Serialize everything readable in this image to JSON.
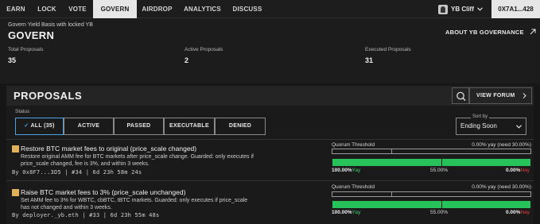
{
  "nav": {
    "tabs": [
      "EARN",
      "LOCK",
      "VOTE",
      "GOVERN",
      "AIRDROP",
      "ANALYTICS",
      "DISCUSS"
    ],
    "active": "GOVERN",
    "user_name": "YB Cliff",
    "wallet": "0X7A1...428"
  },
  "header": {
    "subtitle": "Govern Yield Basis with locked YB",
    "title": "GOVERN",
    "about_link": "ABOUT YB GOVERNANCE",
    "stats": [
      {
        "label": "Total Proposals",
        "value": "35"
      },
      {
        "label": "Active Proposals",
        "value": "2"
      },
      {
        "label": "Executed Proposals",
        "value": "31"
      }
    ]
  },
  "proposals": {
    "title": "PROPOSALS",
    "forum_button": "VIEW FORUM",
    "status_label": "Status",
    "filters": [
      "ALL (35)",
      "ACTIVE",
      "PASSED",
      "EXECUTABLE",
      "DENIED"
    ],
    "active_filter": "ALL (35)",
    "sort_label": "Sort by",
    "sort_value": "Ending Soon",
    "items": [
      {
        "title": "Restore BTC market fees to original (price_scale changed)",
        "description": "Restore original AMM fee for BTC markets after price_scale change. Guarded: only executes if price_scale changed, fee is 3%, and within 3 weeks.",
        "meta": "By 0x8F7...3D5 | #34 | 6d 23h 58m 24s",
        "quorum_label": "Quorum Threshold",
        "quorum_status": "0.00% yay (need 30.00%)",
        "quorum_progress": 0.0,
        "quorum_threshold": 30.0,
        "yay_pct": "100.00%",
        "yay_word": "Yay",
        "pass_threshold": "55.00%",
        "nay_pct": "0.00%",
        "nay_word": "Nay",
        "yay_fraction": 1.0
      },
      {
        "title": "Raise BTC market fees to 3% (price_scale unchanged)",
        "description": "Set AMM fee to 3% for WBTC, cbBTC, tBTC markets. Guarded: only executes if price_scale has not changed and within 3 weeks.",
        "meta": "By deployer._yb.eth | #33 | 6d 23h 55m 48s",
        "quorum_label": "Quorum Threshold",
        "quorum_status": "0.00% yay (need 30.00%)",
        "quorum_progress": 0.0,
        "quorum_threshold": 30.0,
        "yay_pct": "100.00%",
        "yay_word": "Yay",
        "pass_threshold": "55.00%",
        "nay_pct": "0.00%",
        "nay_word": "Nay",
        "yay_fraction": 1.0
      }
    ]
  },
  "colors": {
    "yay": "#27c25a",
    "nay": "#e23a3a",
    "filter_active": "#4aa3e0",
    "proposal_marker": "#e0b15a"
  },
  "icons": [
    "user-avatar-icon",
    "chevron-down-icon",
    "arrow-up-right-icon",
    "search-icon",
    "chevron-right-icon"
  ]
}
